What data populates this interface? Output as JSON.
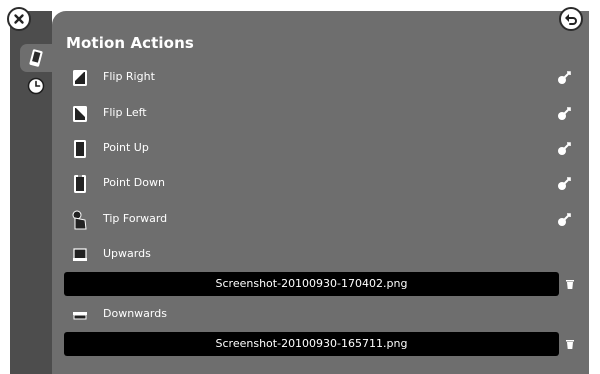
{
  "panel": {
    "title": "Motion Actions"
  },
  "actions": [
    {
      "label": "Flip Right"
    },
    {
      "label": "Flip Left"
    },
    {
      "label": "Point Up"
    },
    {
      "label": "Point Down"
    },
    {
      "label": "Tip Forward"
    },
    {
      "label": "Upwards",
      "file": "Screenshot-20100930-170402.png"
    },
    {
      "label": "Downwards",
      "file": "Screenshot-20100930-165711.png"
    }
  ],
  "icons": {
    "close": "close-icon",
    "back": "back-arrow-icon",
    "motion_tab": "phone-tilt-icon",
    "history_tab": "clock-icon",
    "assign": "wand-icon",
    "remove": "trash-icon"
  },
  "colors": {
    "panel_bg": "#6e6e6e",
    "rail_bg": "#4d4d4d",
    "file_bar_bg": "#000000",
    "text": "#ffffff"
  }
}
